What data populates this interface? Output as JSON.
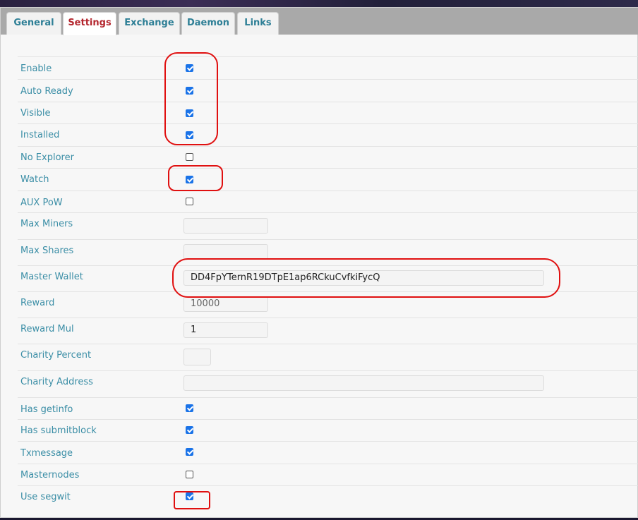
{
  "tabs": [
    {
      "label": "General",
      "active": false
    },
    {
      "label": "Settings",
      "active": true
    },
    {
      "label": "Exchange",
      "active": false
    },
    {
      "label": "Daemon",
      "active": false
    },
    {
      "label": "Links",
      "active": false
    }
  ],
  "settings": {
    "enable": {
      "label": "Enable",
      "checked": true
    },
    "auto_ready": {
      "label": "Auto Ready",
      "checked": true
    },
    "visible": {
      "label": "Visible",
      "checked": true
    },
    "installed": {
      "label": "Installed",
      "checked": true
    },
    "no_explorer": {
      "label": "No Explorer",
      "checked": false
    },
    "watch": {
      "label": "Watch",
      "checked": true
    },
    "aux_pow": {
      "label": "AUX PoW",
      "checked": false
    },
    "max_miners": {
      "label": "Max Miners",
      "value": ""
    },
    "max_shares": {
      "label": "Max Shares",
      "value": ""
    },
    "master_wallet": {
      "label": "Master Wallet",
      "value": "DD4FpYTernR19DTpE1ap6RCkuCvfkiFycQ"
    },
    "reward": {
      "label": "Reward",
      "value": "10000"
    },
    "reward_mul": {
      "label": "Reward Mul",
      "value": "1"
    },
    "charity_percent": {
      "label": "Charity Percent",
      "value": ""
    },
    "charity_address": {
      "label": "Charity Address",
      "value": ""
    },
    "has_getinfo": {
      "label": "Has getinfo",
      "checked": true
    },
    "has_submitblock": {
      "label": "Has submitblock",
      "checked": true
    },
    "txmessage": {
      "label": "Txmessage",
      "checked": true
    },
    "masternodes": {
      "label": "Masternodes",
      "checked": false
    },
    "use_segwit": {
      "label": "Use segwit",
      "checked": true
    }
  },
  "colors": {
    "label": "#3b8ea6",
    "active_tab": "#b4262e",
    "checkbox": "#1a73e8",
    "annotation": "#e01010"
  }
}
